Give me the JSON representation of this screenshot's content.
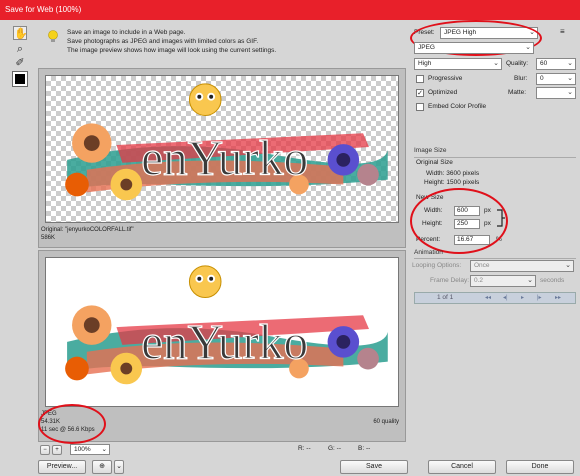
{
  "window": {
    "title": "Save for Web (100%)"
  },
  "tools": [
    {
      "name": "hand-tool-icon",
      "glyph": "✋"
    },
    {
      "name": "zoom-tool-icon",
      "glyph": "⌕"
    },
    {
      "name": "eyedropper-tool-icon",
      "glyph": "✐"
    }
  ],
  "info": {
    "lines": [
      "Save an image to include in a Web page.",
      "Save photographs as JPEG and images with limited colors as GIF.",
      "The image preview shows how image will look using the current settings."
    ]
  },
  "preview_top": {
    "caption_line1": "Original: \"jenyurkoCOLORFALL.tif\"",
    "caption_line2": "586K",
    "wordmark": "enYurko"
  },
  "preview_bottom": {
    "format": "JPEG",
    "size": "54.31K",
    "time": "11 sec @ 56.6 Kbps",
    "quality_label": "60 quality",
    "wordmark": "enYurko"
  },
  "status_bar": {
    "zoom": "100%",
    "r_label": "R: --",
    "g_label": "G: --",
    "b_label": "B: --"
  },
  "settings": {
    "preset_label": "Preset:",
    "preset_value": "JPEG High",
    "format_value": "JPEG",
    "quality_mode": "High",
    "quality_label": "Quality:",
    "quality_value": "60",
    "blur_label": "Blur:",
    "blur_value": "0",
    "matte_label": "Matte:",
    "progressive_label": "Progressive",
    "optimized_label": "Optimized",
    "embed_label": "Embed Color Profile"
  },
  "image_size": {
    "header": "Image Size",
    "original_header": "Original Size",
    "orig_width": "Width: 3600 pixels",
    "orig_height": "Height: 1500 pixels",
    "new_header": "New Size",
    "width_label": "Width:",
    "width_value": "600",
    "height_label": "Height:",
    "height_value": "250",
    "unit": "px",
    "percent_label": "Percent:",
    "percent_value": "16.67",
    "percent_unit": "%"
  },
  "animation": {
    "header": "Animation",
    "looping_label": "Looping Options:",
    "looping_value": "Once",
    "frame_delay_label": "Frame Delay:",
    "frame_delay_value": "0.2",
    "seconds_label": "seconds",
    "frame_counter": "1 of 1"
  },
  "buttons": {
    "preview": "Preview...",
    "save": "Save",
    "cancel": "Cancel",
    "done": "Done"
  }
}
